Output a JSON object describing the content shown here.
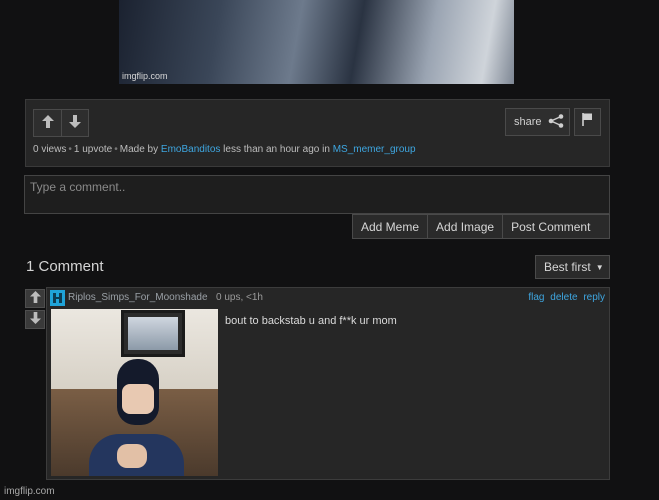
{
  "post": {
    "image_watermark": "imgflip.com",
    "share_label": "share",
    "meta": {
      "views": "0 views",
      "upvotes": "1 upvote",
      "made_by_prefix": "Made by",
      "author": "EmoBanditos",
      "time": "less than an hour ago in",
      "stream": "MS_memer_group"
    }
  },
  "comment_form": {
    "placeholder": "Type a comment..",
    "add_meme": "Add Meme",
    "add_image": "Add Image",
    "post_comment": "Post Comment"
  },
  "comments": {
    "heading": "1 Comment",
    "sort_selected": "Best first",
    "items": [
      {
        "username": "Riplos_Simps_For_Moonshade",
        "stats": "0 ups, <1h",
        "actions": [
          "flag",
          "delete",
          "reply"
        ],
        "text": "bout to backstab u and f**k ur mom"
      }
    ]
  },
  "footer": {
    "watermark": "imgflip.com"
  },
  "colors": {
    "link": "#3ea6e0",
    "avatar": "#1fa3d8",
    "background": "#111112",
    "panel": "#262626"
  },
  "icons": [
    "arrow-up-icon",
    "arrow-down-icon",
    "share-icon",
    "flag-icon",
    "caret-down-icon"
  ]
}
